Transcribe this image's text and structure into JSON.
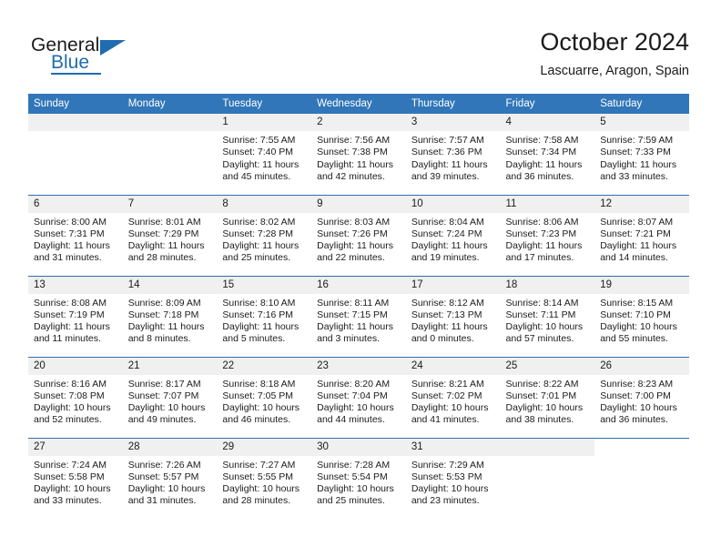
{
  "brand": {
    "name_part1": "General",
    "name_part2": "Blue",
    "accent_color": "#1f6cb0"
  },
  "header": {
    "title": "October 2024",
    "subtitle": "Lascuarre, Aragon, Spain"
  },
  "calendar": {
    "header_bg": "#3176b8",
    "daynum_bg": "#f0f0f0",
    "weekday_headers": [
      "Sunday",
      "Monday",
      "Tuesday",
      "Wednesday",
      "Thursday",
      "Friday",
      "Saturday"
    ],
    "weeks": [
      [
        {
          "day": "",
          "blank": true,
          "sunrise": "",
          "sunset": "",
          "daylight_line1": "",
          "daylight_line2": ""
        },
        {
          "day": "",
          "blank": true,
          "sunrise": "",
          "sunset": "",
          "daylight_line1": "",
          "daylight_line2": ""
        },
        {
          "day": "1",
          "sunrise": "Sunrise: 7:55 AM",
          "sunset": "Sunset: 7:40 PM",
          "daylight_line1": "Daylight: 11 hours",
          "daylight_line2": "and 45 minutes."
        },
        {
          "day": "2",
          "sunrise": "Sunrise: 7:56 AM",
          "sunset": "Sunset: 7:38 PM",
          "daylight_line1": "Daylight: 11 hours",
          "daylight_line2": "and 42 minutes."
        },
        {
          "day": "3",
          "sunrise": "Sunrise: 7:57 AM",
          "sunset": "Sunset: 7:36 PM",
          "daylight_line1": "Daylight: 11 hours",
          "daylight_line2": "and 39 minutes."
        },
        {
          "day": "4",
          "sunrise": "Sunrise: 7:58 AM",
          "sunset": "Sunset: 7:34 PM",
          "daylight_line1": "Daylight: 11 hours",
          "daylight_line2": "and 36 minutes."
        },
        {
          "day": "5",
          "sunrise": "Sunrise: 7:59 AM",
          "sunset": "Sunset: 7:33 PM",
          "daylight_line1": "Daylight: 11 hours",
          "daylight_line2": "and 33 minutes."
        }
      ],
      [
        {
          "day": "6",
          "sunrise": "Sunrise: 8:00 AM",
          "sunset": "Sunset: 7:31 PM",
          "daylight_line1": "Daylight: 11 hours",
          "daylight_line2": "and 31 minutes."
        },
        {
          "day": "7",
          "sunrise": "Sunrise: 8:01 AM",
          "sunset": "Sunset: 7:29 PM",
          "daylight_line1": "Daylight: 11 hours",
          "daylight_line2": "and 28 minutes."
        },
        {
          "day": "8",
          "sunrise": "Sunrise: 8:02 AM",
          "sunset": "Sunset: 7:28 PM",
          "daylight_line1": "Daylight: 11 hours",
          "daylight_line2": "and 25 minutes."
        },
        {
          "day": "9",
          "sunrise": "Sunrise: 8:03 AM",
          "sunset": "Sunset: 7:26 PM",
          "daylight_line1": "Daylight: 11 hours",
          "daylight_line2": "and 22 minutes."
        },
        {
          "day": "10",
          "sunrise": "Sunrise: 8:04 AM",
          "sunset": "Sunset: 7:24 PM",
          "daylight_line1": "Daylight: 11 hours",
          "daylight_line2": "and 19 minutes."
        },
        {
          "day": "11",
          "sunrise": "Sunrise: 8:06 AM",
          "sunset": "Sunset: 7:23 PM",
          "daylight_line1": "Daylight: 11 hours",
          "daylight_line2": "and 17 minutes."
        },
        {
          "day": "12",
          "sunrise": "Sunrise: 8:07 AM",
          "sunset": "Sunset: 7:21 PM",
          "daylight_line1": "Daylight: 11 hours",
          "daylight_line2": "and 14 minutes."
        }
      ],
      [
        {
          "day": "13",
          "sunrise": "Sunrise: 8:08 AM",
          "sunset": "Sunset: 7:19 PM",
          "daylight_line1": "Daylight: 11 hours",
          "daylight_line2": "and 11 minutes."
        },
        {
          "day": "14",
          "sunrise": "Sunrise: 8:09 AM",
          "sunset": "Sunset: 7:18 PM",
          "daylight_line1": "Daylight: 11 hours",
          "daylight_line2": "and 8 minutes."
        },
        {
          "day": "15",
          "sunrise": "Sunrise: 8:10 AM",
          "sunset": "Sunset: 7:16 PM",
          "daylight_line1": "Daylight: 11 hours",
          "daylight_line2": "and 5 minutes."
        },
        {
          "day": "16",
          "sunrise": "Sunrise: 8:11 AM",
          "sunset": "Sunset: 7:15 PM",
          "daylight_line1": "Daylight: 11 hours",
          "daylight_line2": "and 3 minutes."
        },
        {
          "day": "17",
          "sunrise": "Sunrise: 8:12 AM",
          "sunset": "Sunset: 7:13 PM",
          "daylight_line1": "Daylight: 11 hours",
          "daylight_line2": "and 0 minutes."
        },
        {
          "day": "18",
          "sunrise": "Sunrise: 8:14 AM",
          "sunset": "Sunset: 7:11 PM",
          "daylight_line1": "Daylight: 10 hours",
          "daylight_line2": "and 57 minutes."
        },
        {
          "day": "19",
          "sunrise": "Sunrise: 8:15 AM",
          "sunset": "Sunset: 7:10 PM",
          "daylight_line1": "Daylight: 10 hours",
          "daylight_line2": "and 55 minutes."
        }
      ],
      [
        {
          "day": "20",
          "sunrise": "Sunrise: 8:16 AM",
          "sunset": "Sunset: 7:08 PM",
          "daylight_line1": "Daylight: 10 hours",
          "daylight_line2": "and 52 minutes."
        },
        {
          "day": "21",
          "sunrise": "Sunrise: 8:17 AM",
          "sunset": "Sunset: 7:07 PM",
          "daylight_line1": "Daylight: 10 hours",
          "daylight_line2": "and 49 minutes."
        },
        {
          "day": "22",
          "sunrise": "Sunrise: 8:18 AM",
          "sunset": "Sunset: 7:05 PM",
          "daylight_line1": "Daylight: 10 hours",
          "daylight_line2": "and 46 minutes."
        },
        {
          "day": "23",
          "sunrise": "Sunrise: 8:20 AM",
          "sunset": "Sunset: 7:04 PM",
          "daylight_line1": "Daylight: 10 hours",
          "daylight_line2": "and 44 minutes."
        },
        {
          "day": "24",
          "sunrise": "Sunrise: 8:21 AM",
          "sunset": "Sunset: 7:02 PM",
          "daylight_line1": "Daylight: 10 hours",
          "daylight_line2": "and 41 minutes."
        },
        {
          "day": "25",
          "sunrise": "Sunrise: 8:22 AM",
          "sunset": "Sunset: 7:01 PM",
          "daylight_line1": "Daylight: 10 hours",
          "daylight_line2": "and 38 minutes."
        },
        {
          "day": "26",
          "sunrise": "Sunrise: 8:23 AM",
          "sunset": "Sunset: 7:00 PM",
          "daylight_line1": "Daylight: 10 hours",
          "daylight_line2": "and 36 minutes."
        }
      ],
      [
        {
          "day": "27",
          "sunrise": "Sunrise: 7:24 AM",
          "sunset": "Sunset: 5:58 PM",
          "daylight_line1": "Daylight: 10 hours",
          "daylight_line2": "and 33 minutes."
        },
        {
          "day": "28",
          "sunrise": "Sunrise: 7:26 AM",
          "sunset": "Sunset: 5:57 PM",
          "daylight_line1": "Daylight: 10 hours",
          "daylight_line2": "and 31 minutes."
        },
        {
          "day": "29",
          "sunrise": "Sunrise: 7:27 AM",
          "sunset": "Sunset: 5:55 PM",
          "daylight_line1": "Daylight: 10 hours",
          "daylight_line2": "and 28 minutes."
        },
        {
          "day": "30",
          "sunrise": "Sunrise: 7:28 AM",
          "sunset": "Sunset: 5:54 PM",
          "daylight_line1": "Daylight: 10 hours",
          "daylight_line2": "and 25 minutes."
        },
        {
          "day": "31",
          "sunrise": "Sunrise: 7:29 AM",
          "sunset": "Sunset: 5:53 PM",
          "daylight_line1": "Daylight: 10 hours",
          "daylight_line2": "and 23 minutes."
        },
        {
          "day": "",
          "blank": true,
          "sunrise": "",
          "sunset": "",
          "daylight_line1": "",
          "daylight_line2": ""
        },
        {
          "day": "",
          "blank": true,
          "trailing": true,
          "sunrise": "",
          "sunset": "",
          "daylight_line1": "",
          "daylight_line2": ""
        }
      ]
    ]
  }
}
